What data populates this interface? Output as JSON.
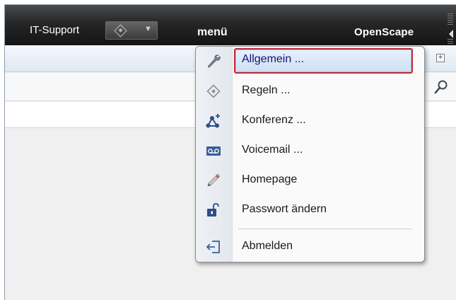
{
  "header": {
    "user_label": "IT-Support",
    "menu_title": "menü",
    "brand": "OpenScape"
  },
  "menu": {
    "items": [
      {
        "label": "Allgemein ...",
        "icon": "wrench-icon",
        "selected": true
      },
      {
        "label": "Regeln ...",
        "icon": "diamond-icon"
      },
      {
        "label": "Konferenz ...",
        "icon": "conference-add-icon"
      },
      {
        "label": "Voicemail ...",
        "icon": "voicemail-icon"
      },
      {
        "label": "Homepage",
        "icon": "pencil-icon"
      },
      {
        "label": "Passwort ändern",
        "icon": "unlocked-padlock-icon"
      },
      {
        "label": "Abmelden",
        "icon": "logout-arrow-icon"
      }
    ]
  },
  "colors": {
    "topbar": "#262626",
    "selection_border": "#c0283a",
    "selected_text": "#10127a",
    "icon_blue": "#2b4f86"
  }
}
